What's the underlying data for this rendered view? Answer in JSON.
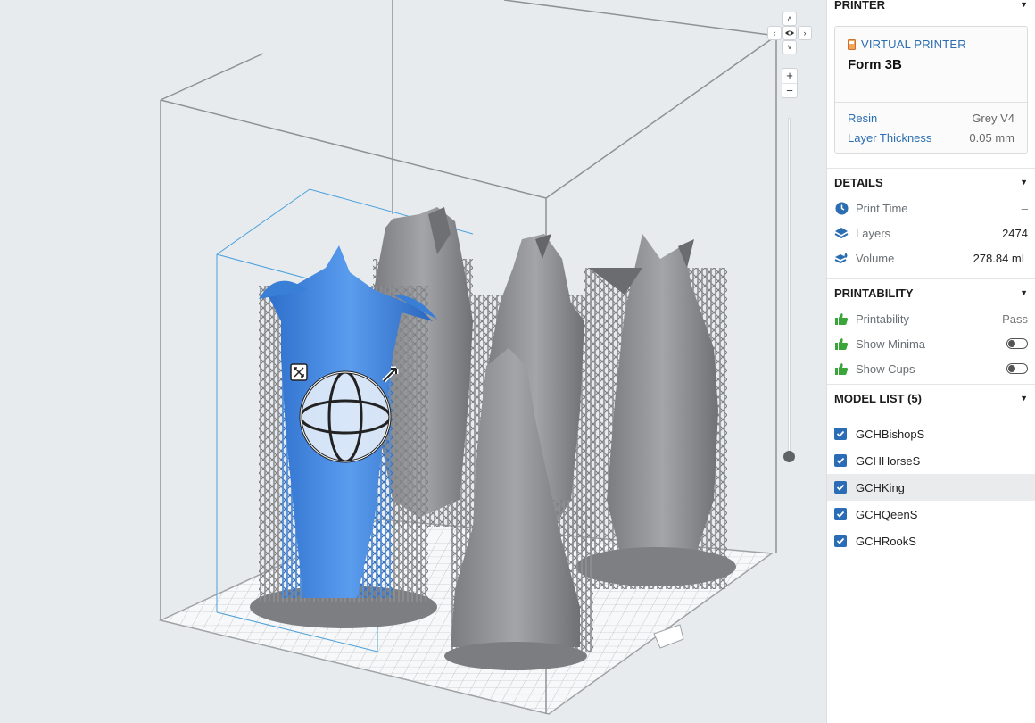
{
  "colors": {
    "accent": "#2a6db0",
    "selected_model": "#3d86e0",
    "model_grey": "#8d8f92",
    "pass_green": "#3aa63a"
  },
  "viewport": {
    "nav": {
      "up": "˄",
      "down": "˅",
      "left": "‹",
      "right": "›",
      "center_icon": "eye-icon"
    },
    "zoom": {
      "in": "+",
      "out": "−"
    }
  },
  "printer": {
    "header": "PRINTER",
    "kind_label": "VIRTUAL PRINTER",
    "model": "Form 3B",
    "props": [
      {
        "label": "Resin",
        "value": "Grey V4"
      },
      {
        "label": "Layer Thickness",
        "value": "0.05 mm"
      }
    ]
  },
  "details": {
    "header": "DETAILS",
    "print_time": {
      "label": "Print Time",
      "value": "–"
    },
    "layers": {
      "label": "Layers",
      "value": "2474"
    },
    "volume": {
      "label": "Volume",
      "value": "278.84 mL"
    }
  },
  "printability": {
    "header": "PRINTABILITY",
    "status": {
      "label": "Printability",
      "value": "Pass"
    },
    "show_minima": {
      "label": "Show Minima",
      "on": false
    },
    "show_cups": {
      "label": "Show Cups",
      "on": false
    }
  },
  "model_list": {
    "header": "MODEL LIST (5)",
    "items": [
      {
        "name": "GCHBishopS",
        "checked": true,
        "selected": false
      },
      {
        "name": "GCHHorseS",
        "checked": true,
        "selected": false
      },
      {
        "name": "GCHKing",
        "checked": true,
        "selected": true
      },
      {
        "name": "GCHQeenS",
        "checked": true,
        "selected": false
      },
      {
        "name": "GCHRookS",
        "checked": true,
        "selected": false
      }
    ]
  }
}
